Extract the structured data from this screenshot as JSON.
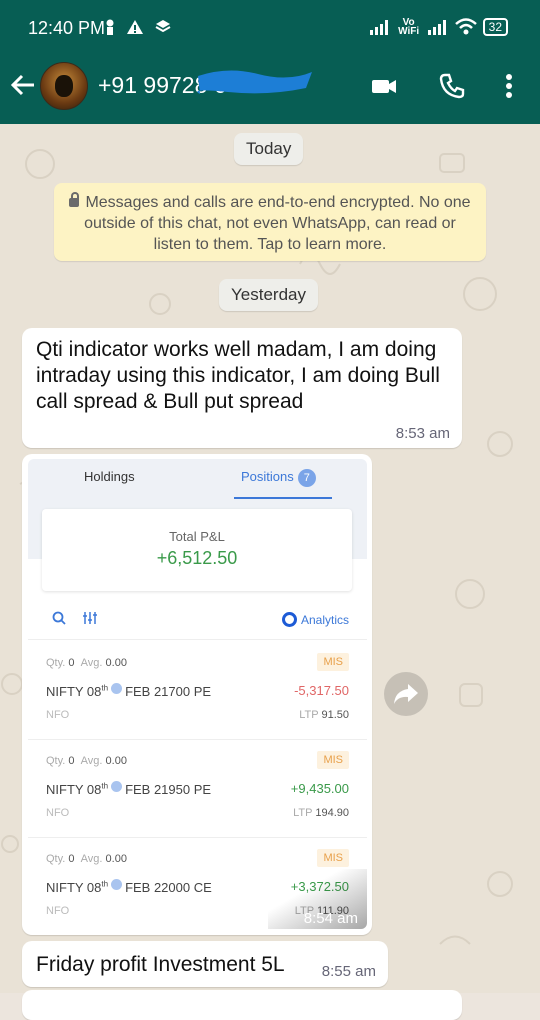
{
  "status_bar": {
    "time": "12:40 PM",
    "vowifi": "Vo WiFi",
    "battery": "32"
  },
  "app_bar": {
    "contact": "+91 99728 6"
  },
  "chat": {
    "date_today": "Today",
    "encryption_notice": "Messages and calls are end-to-end encrypted. No one outside of this chat, not even WhatsApp, can read or listen to them. Tap to learn more.",
    "date_yesterday": "Yesterday",
    "messages": [
      {
        "text": "Qti indicator works well madam, I am doing intraday using this indicator, I am doing Bull call spread &  Bull put spread",
        "time": "8:53 am"
      },
      {
        "text": "",
        "time": "8:54 am"
      },
      {
        "text": "Friday profit Investment 5L",
        "time": "8:55 am"
      }
    ]
  },
  "screenshot": {
    "tab_holdings": "Holdings",
    "tab_positions": "Positions",
    "positions_count": "7",
    "total_pl_label": "Total P&L",
    "total_pl_value": "+6,512.50",
    "analytics": "Analytics",
    "rows": [
      {
        "qty_label": "Qty.",
        "qty": "0",
        "avg_label": "Avg.",
        "avg": "0.00",
        "product": "MIS",
        "symbol": "NIFTY 08",
        "sup": "th",
        "contract": "FEB 21700 PE",
        "pl": "-5,317.50",
        "pl_color": "#e06666",
        "exchange": "NFO",
        "ltp_label": "LTP",
        "ltp": "91.50"
      },
      {
        "qty_label": "Qty.",
        "qty": "0",
        "avg_label": "Avg.",
        "avg": "0.00",
        "product": "MIS",
        "symbol": "NIFTY 08",
        "sup": "th",
        "contract": "FEB 21950 PE",
        "pl": "+9,435.00",
        "pl_color": "#3a9a4a",
        "exchange": "NFO",
        "ltp_label": "LTP",
        "ltp": "194.90"
      },
      {
        "qty_label": "Qty.",
        "qty": "0",
        "avg_label": "Avg.",
        "avg": "0.00",
        "product": "MIS",
        "symbol": "NIFTY 08",
        "sup": "th",
        "contract": "FEB 22000 CE",
        "pl": "+3,372.50",
        "pl_color": "#3a9a4a",
        "exchange": "NFO",
        "ltp_label": "LTP",
        "ltp": "111.90"
      }
    ]
  },
  "colors": {
    "header": "#075e54",
    "wallpaper": "#e9e2d6",
    "notice": "#fdf3c4"
  }
}
